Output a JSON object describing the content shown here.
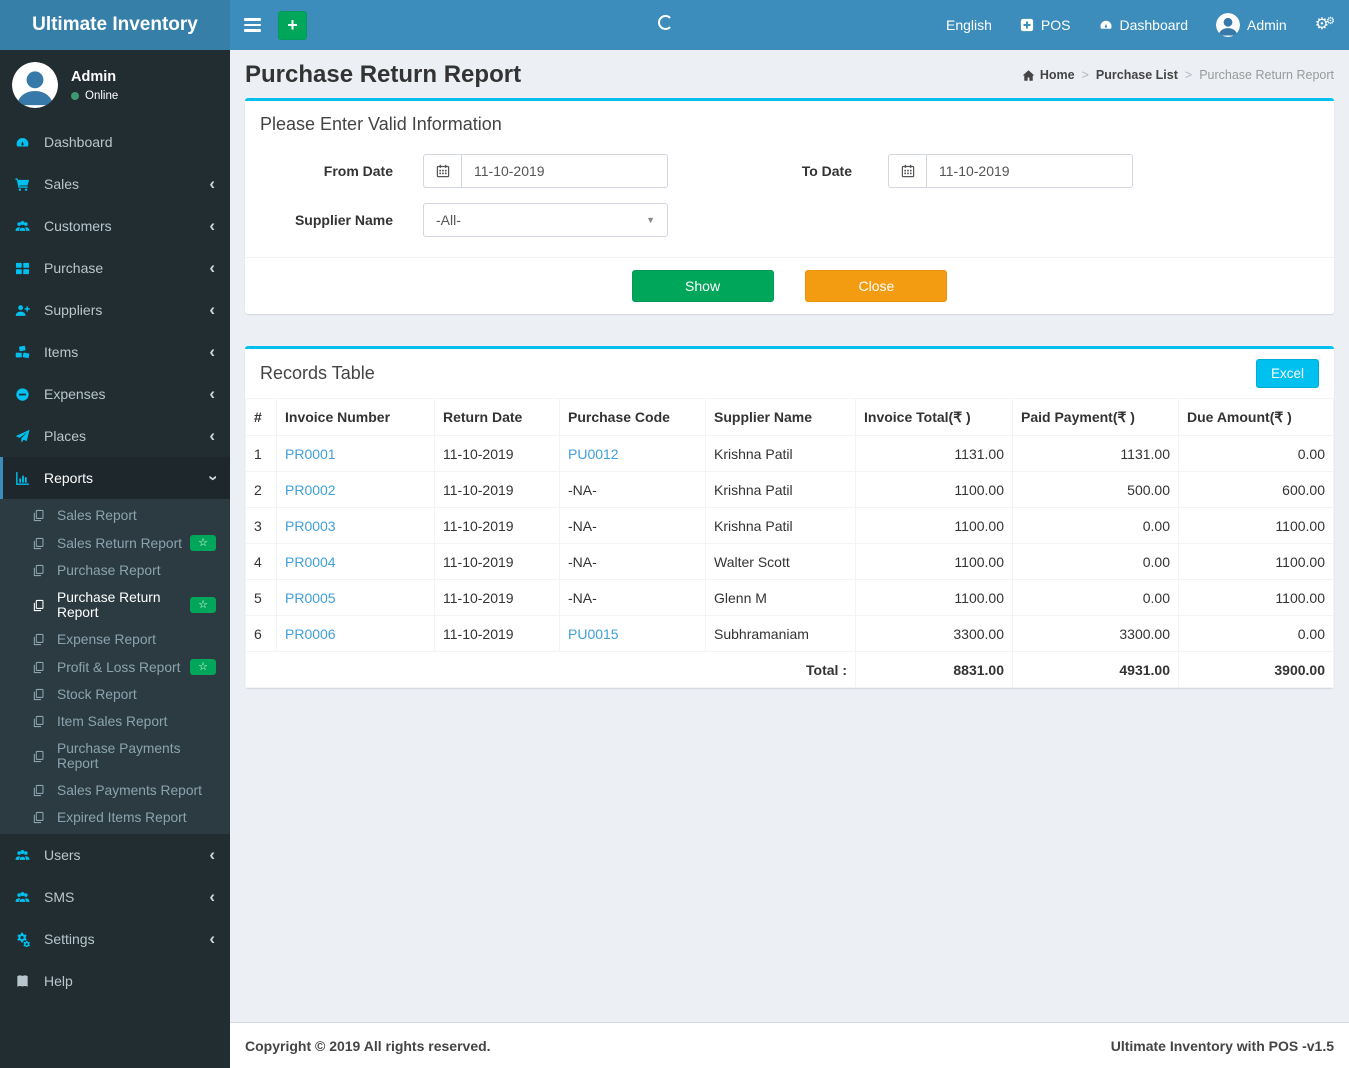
{
  "header": {
    "logo": "Ultimate Inventory",
    "quick_add_label": "+",
    "nav": {
      "english": "English",
      "pos": "POS",
      "dashboard": "Dashboard",
      "admin": "Admin"
    }
  },
  "sidebar": {
    "user": {
      "name": "Admin",
      "status": "Online"
    },
    "menu": [
      {
        "label": "Dashboard",
        "icon": "tachometer",
        "chevron": ""
      },
      {
        "label": "Sales",
        "icon": "cart",
        "chevron": "left"
      },
      {
        "label": "Customers",
        "icon": "users",
        "chevron": "left"
      },
      {
        "label": "Purchase",
        "icon": "grid",
        "chevron": "left"
      },
      {
        "label": "Suppliers",
        "icon": "user-plus",
        "chevron": "left"
      },
      {
        "label": "Items",
        "icon": "cubes",
        "chevron": "left"
      },
      {
        "label": "Expenses",
        "icon": "minus-circle",
        "chevron": "left"
      },
      {
        "label": "Places",
        "icon": "paper-plane",
        "chevron": "left"
      },
      {
        "label": "Reports",
        "icon": "bar-chart",
        "chevron": "down",
        "active": true,
        "children": [
          {
            "label": "Sales Report"
          },
          {
            "label": "Sales Return Report",
            "badge": "star"
          },
          {
            "label": "Purchase Report"
          },
          {
            "label": "Purchase Return Report",
            "badge": "star",
            "active": true
          },
          {
            "label": "Expense Report"
          },
          {
            "label": "Profit & Loss Report",
            "badge": "star"
          },
          {
            "label": "Stock Report"
          },
          {
            "label": "Item Sales Report"
          },
          {
            "label": "Purchase Payments Report"
          },
          {
            "label": "Sales Payments Report"
          },
          {
            "label": "Expired Items Report"
          }
        ]
      },
      {
        "label": "Users",
        "icon": "users",
        "chevron": "left"
      },
      {
        "label": "SMS",
        "icon": "users",
        "chevron": "left"
      },
      {
        "label": "Settings",
        "icon": "cogs",
        "chevron": "left"
      },
      {
        "label": "Help",
        "icon": "book",
        "chevron": "",
        "muted_icon": true
      }
    ]
  },
  "page": {
    "title": "Purchase Return Report",
    "breadcrumb": [
      {
        "label": "Home"
      },
      {
        "label": "Purchase List"
      },
      {
        "label": "Purchase Return Report"
      }
    ]
  },
  "filter": {
    "title": "Please Enter Valid Information",
    "from_date": {
      "label": "From Date",
      "value": "11-10-2019"
    },
    "to_date": {
      "label": "To Date",
      "value": "11-10-2019"
    },
    "supplier": {
      "label": "Supplier Name",
      "value": "-All-"
    },
    "show_label": "Show",
    "close_label": "Close"
  },
  "records": {
    "title": "Records Table",
    "excel_label": "Excel",
    "columns": [
      "#",
      "Invoice Number",
      "Return Date",
      "Purchase Code",
      "Supplier Name",
      "Invoice Total(₹ )",
      "Paid Payment(₹ )",
      "Due Amount(₹ )"
    ],
    "rows": [
      {
        "sno": "1",
        "invoice": "PR0001",
        "date": "11-10-2019",
        "code": "PU0012",
        "code_is_link": true,
        "supplier": "Krishna Patil",
        "total": "1131.00",
        "paid": "1131.00",
        "due": "0.00"
      },
      {
        "sno": "2",
        "invoice": "PR0002",
        "date": "11-10-2019",
        "code": "-NA-",
        "code_is_link": false,
        "supplier": "Krishna Patil",
        "total": "1100.00",
        "paid": "500.00",
        "due": "600.00"
      },
      {
        "sno": "3",
        "invoice": "PR0003",
        "date": "11-10-2019",
        "code": "-NA-",
        "code_is_link": false,
        "supplier": "Krishna Patil",
        "total": "1100.00",
        "paid": "0.00",
        "due": "1100.00"
      },
      {
        "sno": "4",
        "invoice": "PR0004",
        "date": "11-10-2019",
        "code": "-NA-",
        "code_is_link": false,
        "supplier": "Walter Scott",
        "total": "1100.00",
        "paid": "0.00",
        "due": "1100.00"
      },
      {
        "sno": "5",
        "invoice": "PR0005",
        "date": "11-10-2019",
        "code": "-NA-",
        "code_is_link": false,
        "supplier": "Glenn M",
        "total": "1100.00",
        "paid": "0.00",
        "due": "1100.00"
      },
      {
        "sno": "6",
        "invoice": "PR0006",
        "date": "11-10-2019",
        "code": "PU0015",
        "code_is_link": true,
        "supplier": "Subhramaniam",
        "total": "3300.00",
        "paid": "3300.00",
        "due": "0.00"
      }
    ],
    "total": {
      "label": "Total :",
      "total": "8831.00",
      "paid": "4931.00",
      "due": "3900.00"
    }
  },
  "footer": {
    "left": "Copyright © 2019 All rights reserved.",
    "right": "Ultimate Inventory with POS -v1.5"
  },
  "colors": {
    "navbar": "#3c8dbc",
    "logo_bg": "#367fa9",
    "sidebar_bg": "#222d32",
    "accent_cyan": "#00c0ef",
    "green": "#00a65a",
    "orange": "#f39c12",
    "link": "#41a0d8"
  }
}
